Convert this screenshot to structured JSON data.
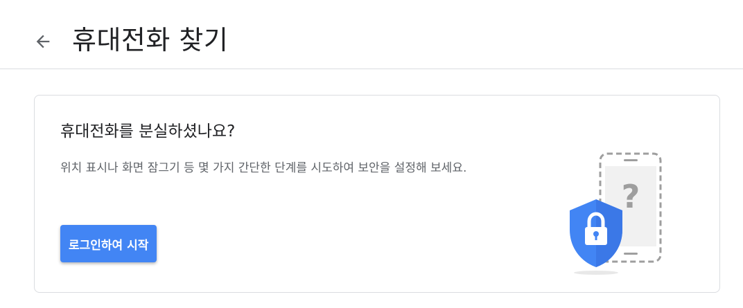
{
  "header": {
    "back_icon": "arrow-back-icon",
    "title": "휴대전화 찾기"
  },
  "card": {
    "title": "휴대전화를 분실하셨나요?",
    "description": "위치 표시나 화면 잠그기 등 몇 가지 간단한 단계를 시도하여 보안을 설정해 보세요.",
    "start_button_label": "로그인하여 시작",
    "illustration": {
      "phone_icon": "phone-outline-icon",
      "question_icon": "question-mark-icon",
      "shield_icon": "shield-lock-icon",
      "question_text": "?"
    }
  },
  "colors": {
    "accent": "#4285f4",
    "title_text": "#202124",
    "secondary_text": "#5f6368",
    "border": "#dadce0"
  }
}
